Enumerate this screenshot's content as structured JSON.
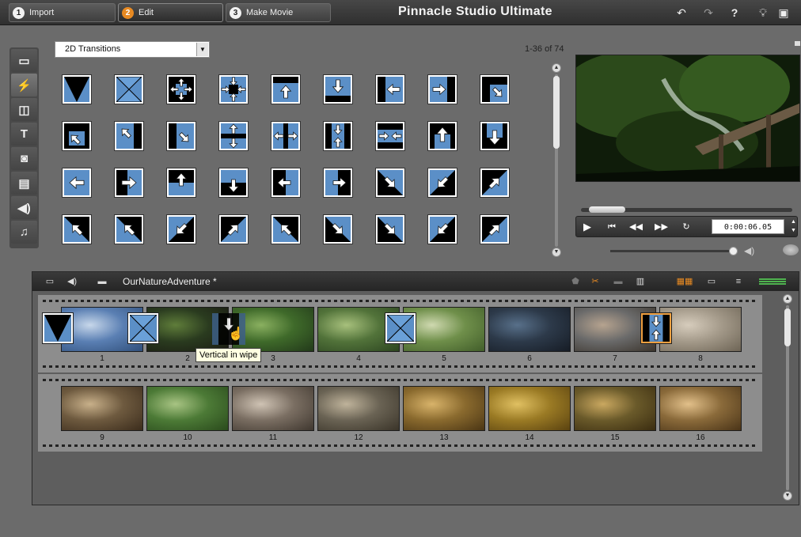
{
  "app": {
    "title": "Pinnacle Studio Ultimate"
  },
  "tabs": [
    {
      "num": "1",
      "label": "Import"
    },
    {
      "num": "2",
      "label": "Edit"
    },
    {
      "num": "3",
      "label": "Make Movie"
    }
  ],
  "top_icons": [
    "undo-icon",
    "redo-icon",
    "help-icon",
    "tips-icon",
    "shop-icon"
  ],
  "categories": [
    "videos-icon",
    "transitions-icon",
    "montage-icon",
    "titles-icon",
    "photos-icon",
    "disc-menus-icon",
    "sound-effects-icon",
    "music-icon"
  ],
  "library": {
    "category_select": "2D Transitions",
    "page_count": "1-36 of 74"
  },
  "player": {
    "timecode": "0:00:06.05",
    "controls": [
      "play-icon",
      "go-to-start-icon",
      "rewind-icon",
      "fast-forward-icon",
      "loop-icon"
    ]
  },
  "storyboard": {
    "project_name": "OurNatureAdventure *",
    "tooltip": "Vertical in wipe",
    "row1": [
      "1",
      "2",
      "3",
      "4",
      "5",
      "6",
      "7",
      "8"
    ],
    "row2": [
      "9",
      "10",
      "11",
      "12",
      "13",
      "14",
      "15",
      "16"
    ]
  },
  "colors": {
    "accent": "#e88a22",
    "transition_blue": "#5b8fc7"
  }
}
